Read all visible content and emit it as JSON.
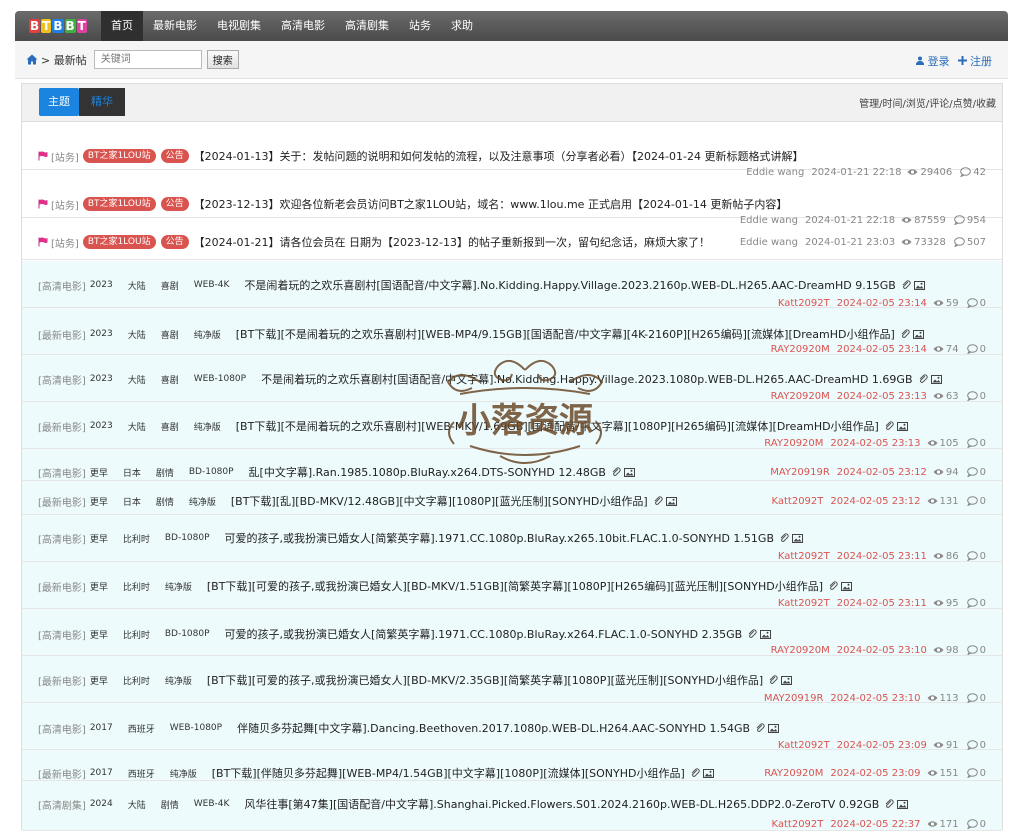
{
  "nav": {
    "logo": [
      "B",
      "T",
      "B",
      "B",
      "T"
    ],
    "items": [
      "首页",
      "最新电影",
      "电视剧集",
      "高清电影",
      "高清剧集",
      "站务",
      "求助"
    ],
    "active_index": 0
  },
  "crumb": {
    "text": "> 最新帖",
    "search_placeholder": "关键词",
    "search_button": "搜索"
  },
  "auth": {
    "login": "登录",
    "register": "注册"
  },
  "tabs": {
    "main": "主题",
    "elite": "精华"
  },
  "sort_links": "管理/时间/浏览/评论/点赞/收藏",
  "watermark_text": "小落资源",
  "sticky": [
    {
      "forum": "[站务]",
      "site": "BT之家1LOU站",
      "badge": "公告",
      "title": "【2024-01-13】关于：发帖问题的说明和如何发帖的流程，以及注意事项（分享者必看）【2024-01-24 更新标题格式讲解】",
      "user": "Eddie wang",
      "date": "2024-01-21 22:18",
      "views": "29406",
      "comments": "42"
    },
    {
      "forum": "[站务]",
      "site": "BT之家1LOU站",
      "badge": "公告",
      "title": "【2023-12-13】欢迎各位新老会员访问BT之家1LOU站，域名：www.1lou.me 正式启用【2024-01-14 更新帖子内容】",
      "user": "Eddie wang",
      "date": "2024-01-21 22:18",
      "views": "87559",
      "comments": "954"
    },
    {
      "forum": "[站务]",
      "site": "BT之家1LOU站",
      "badge": "公告",
      "title": "【2024-01-21】请各位会员在 日期为【2023-12-13】的帖子重新报到一次，留句纪念话，麻烦大家了！",
      "user": "Eddie wang",
      "date": "2024-01-21 23:03",
      "views": "73328",
      "comments": "507"
    }
  ],
  "threads": [
    {
      "forum": "[高清电影]",
      "tags": [
        "2023",
        "大陆",
        "喜剧",
        "WEB-4K"
      ],
      "title": "不是闹着玩的之欢乐喜剧村[国语配音/中文字幕].No.Kidding.Happy.Village.2023.2160p.WEB-DL.H265.AAC-DreamHD 9.15GB",
      "user": "Katt2092T",
      "date": "2024-02-05 23:14",
      "views": "59",
      "comments": "0"
    },
    {
      "forum": "[最新电影]",
      "tags": [
        "2023",
        "大陆",
        "喜剧",
        "纯净版"
      ],
      "title": "[BT下载][不是闹着玩的之欢乐喜剧村][WEB-MP4/9.15GB][国语配音/中文字幕][4K-2160P][H265编码][流媒体][DreamHD小组作品]",
      "user": "RAY20920M",
      "date": "2024-02-05 23:14",
      "views": "74",
      "comments": "0"
    },
    {
      "forum": "[高清电影]",
      "tags": [
        "2023",
        "大陆",
        "喜剧",
        "WEB-1080P"
      ],
      "title": "不是闹着玩的之欢乐喜剧村[国语配音/中文字幕].No.Kidding.Happy.Village.2023.1080p.WEB-DL.H265.AAC-DreamHD 1.69GB",
      "user": "RAY20920M",
      "date": "2024-02-05 23:13",
      "views": "63",
      "comments": "0"
    },
    {
      "forum": "[最新电影]",
      "tags": [
        "2023",
        "大陆",
        "喜剧",
        "纯净版"
      ],
      "title": "[BT下载][不是闹着玩的之欢乐喜剧村][WEB-MKV/1.69GB][国语配音/中文字幕][1080P][H265编码][流媒体][DreamHD小组作品]",
      "user": "RAY20920M",
      "date": "2024-02-05 23:13",
      "views": "105",
      "comments": "0"
    },
    {
      "forum": "[高清电影]",
      "tags": [
        "更早",
        "日本",
        "剧情",
        "BD-1080P"
      ],
      "title": "乱[中文字幕].Ran.1985.1080p.BluRay.x264.DTS-SONYHD 12.48GB",
      "user": "MAY20919R",
      "date": "2024-02-05 23:12",
      "views": "94",
      "comments": "0"
    },
    {
      "forum": "[最新电影]",
      "tags": [
        "更早",
        "日本",
        "剧情",
        "纯净版"
      ],
      "title": "[BT下载][乱][BD-MKV/12.48GB][中文字幕][1080P][蓝光压制][SONYHD小组作品]",
      "user": "Katt2092T",
      "date": "2024-02-05 23:12",
      "views": "131",
      "comments": "0"
    },
    {
      "forum": "[高清电影]",
      "tags": [
        "更早",
        "比利时",
        "BD-1080P"
      ],
      "title": "可爱的孩子,或我扮演已婚女人[简繁英字幕].1971.CC.1080p.BluRay.x265.10bit.FLAC.1.0-SONYHD 1.51GB",
      "user": "Katt2092T",
      "date": "2024-02-05 23:11",
      "views": "86",
      "comments": "0"
    },
    {
      "forum": "[最新电影]",
      "tags": [
        "更早",
        "比利时",
        "纯净版"
      ],
      "title": "[BT下载][可爱的孩子,或我扮演已婚女人][BD-MKV/1.51GB][简繁英字幕][1080P][H265编码][蓝光压制][SONYHD小组作品]",
      "user": "Katt2092T",
      "date": "2024-02-05 23:11",
      "views": "95",
      "comments": "0"
    },
    {
      "forum": "[高清电影]",
      "tags": [
        "更早",
        "比利时",
        "BD-1080P"
      ],
      "title": "可爱的孩子,或我扮演已婚女人[简繁英字幕].1971.CC.1080p.BluRay.x264.FLAC.1.0-SONYHD 2.35GB",
      "user": "RAY20920M",
      "date": "2024-02-05 23:10",
      "views": "98",
      "comments": "0"
    },
    {
      "forum": "[最新电影]",
      "tags": [
        "更早",
        "比利时",
        "纯净版"
      ],
      "title": "[BT下载][可爱的孩子,或我扮演已婚女人][BD-MKV/2.35GB][简繁英字幕][1080P][蓝光压制][SONYHD小组作品]",
      "user": "MAY20919R",
      "date": "2024-02-05 23:10",
      "views": "113",
      "comments": "0"
    },
    {
      "forum": "[高清电影]",
      "tags": [
        "2017",
        "西班牙",
        "WEB-1080P"
      ],
      "title": "伴随贝多芬起舞[中文字幕].Dancing.Beethoven.2017.1080p.WEB-DL.H264.AAC-SONYHD 1.54GB",
      "user": "Katt2092T",
      "date": "2024-02-05 23:09",
      "views": "91",
      "comments": "0"
    },
    {
      "forum": "[最新电影]",
      "tags": [
        "2017",
        "西班牙",
        "纯净版"
      ],
      "title": "[BT下载][伴随贝多芬起舞][WEB-MP4/1.54GB][中文字幕][1080P][流媒体][SONYHD小组作品]",
      "user": "RAY20920M",
      "date": "2024-02-05 23:09",
      "views": "151",
      "comments": "0"
    },
    {
      "forum": "[高清剧集]",
      "tags": [
        "2024",
        "大陆",
        "剧情",
        "WEB-4K"
      ],
      "title": "风华往事[第47集][国语配音/中文字幕].Shanghai.Picked.Flowers.S01.2024.2160p.WEB-DL.H265.DDP2.0-ZeroTV 0.92GB",
      "user": "Katt2092T",
      "date": "2024-02-05 22:37",
      "views": "171",
      "comments": "0"
    }
  ]
}
